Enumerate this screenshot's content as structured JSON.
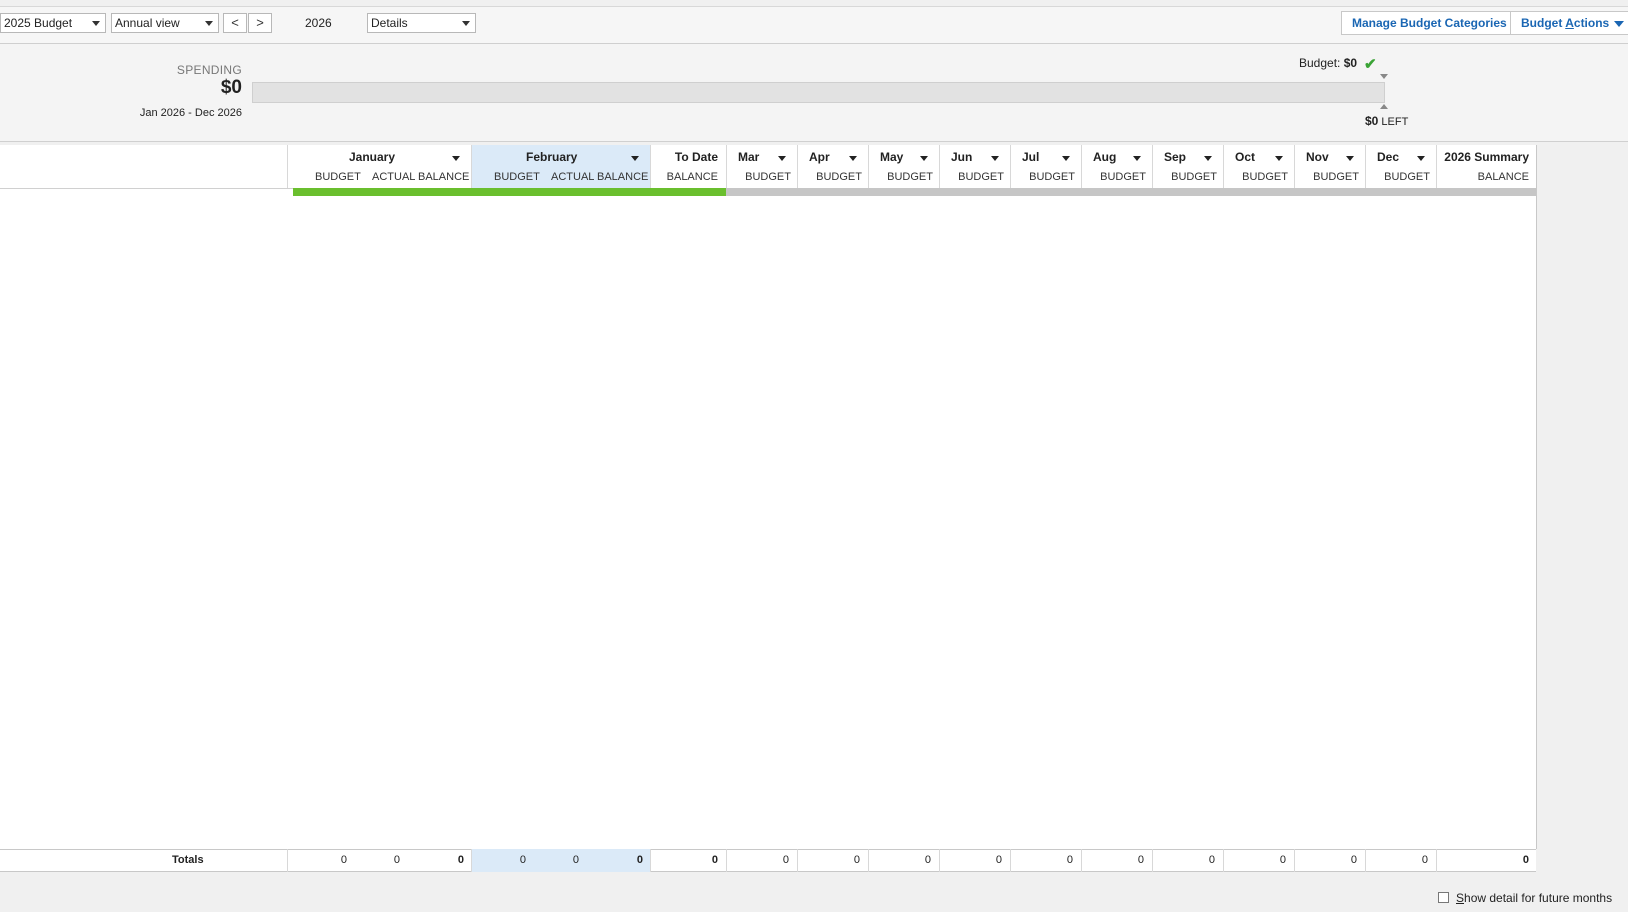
{
  "toolbar": {
    "budget_select": "2025 Budget",
    "view_select": "Annual view",
    "prev_label": "<",
    "next_label": ">",
    "year": "2026",
    "details_select": "Details",
    "manage_label": "Manage Budget Categories",
    "actions_label_pre": "Budget ",
    "actions_label_u": "A",
    "actions_label_post": "ctions"
  },
  "spending": {
    "label": "SPENDING",
    "amount": "$0",
    "range": "Jan 2026 - Dec 2026",
    "budget_label": "Budget:",
    "budget_value": "$0",
    "left_value": "$0",
    "left_label": "LEFT",
    "spent_fraction": 0
  },
  "grid": {
    "january": {
      "name": "January",
      "budget": "BUDGET",
      "actual": "ACTUAL",
      "balance": "BALANCE"
    },
    "february": {
      "name": "February",
      "budget": "BUDGET",
      "actual": "ACTUAL",
      "balance": "BALANCE"
    },
    "todate": {
      "name": "To Date",
      "balance": "BALANCE"
    },
    "months": [
      {
        "name": "Mar",
        "sub": "BUDGET"
      },
      {
        "name": "Apr",
        "sub": "BUDGET"
      },
      {
        "name": "May",
        "sub": "BUDGET"
      },
      {
        "name": "Jun",
        "sub": "BUDGET"
      },
      {
        "name": "Jul",
        "sub": "BUDGET"
      },
      {
        "name": "Aug",
        "sub": "BUDGET"
      },
      {
        "name": "Sep",
        "sub": "BUDGET"
      },
      {
        "name": "Oct",
        "sub": "BUDGET"
      },
      {
        "name": "Nov",
        "sub": "BUDGET"
      },
      {
        "name": "Dec",
        "sub": "BUDGET"
      }
    ],
    "summary": {
      "name": "2026 Summary",
      "balance": "BALANCE"
    }
  },
  "totals": {
    "label": "Totals",
    "jan": [
      "0",
      "0",
      "0"
    ],
    "feb": [
      "0",
      "0",
      "0"
    ],
    "todate": "0",
    "months": [
      "0",
      "0",
      "0",
      "0",
      "0",
      "0",
      "0",
      "0",
      "0",
      "0"
    ],
    "summary": "0"
  },
  "footer": {
    "checkbox_checked": false,
    "label_u": "S",
    "label_rest": "how detail for future months"
  },
  "colors": {
    "accent_green": "#6abf2e",
    "current_month_highlight": "#dbeaf8",
    "link_blue": "#1a66b3"
  }
}
